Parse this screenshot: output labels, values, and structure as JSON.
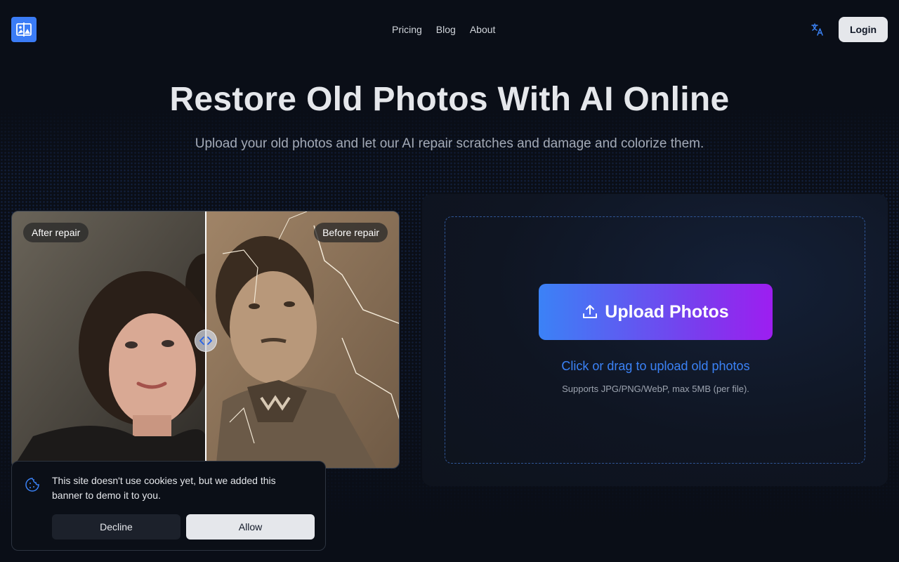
{
  "header": {
    "nav": [
      "Pricing",
      "Blog",
      "About"
    ],
    "login_label": "Login",
    "logo_icon": "photo-compare-icon",
    "language_icon": "translate-icon"
  },
  "hero": {
    "title": "Restore Old Photos With AI Online",
    "subtitle": "Upload your old photos and let our AI repair scratches and damage and colorize them."
  },
  "compare": {
    "after_label": "After repair",
    "before_label": "Before repair"
  },
  "upload": {
    "button_label": "Upload Photos",
    "drag_text": "Click or drag to upload old photos",
    "supports": "Supports JPG/PNG/WebP, max 5MB (per file)."
  },
  "cookie": {
    "message": "This site doesn't use cookies yet, but we added this banner to demo it to you.",
    "decline_label": "Decline",
    "allow_label": "Allow"
  },
  "colors": {
    "accent": "#3b82f6",
    "gradient_end": "#9d1ef0",
    "background": "#0a0e17"
  }
}
